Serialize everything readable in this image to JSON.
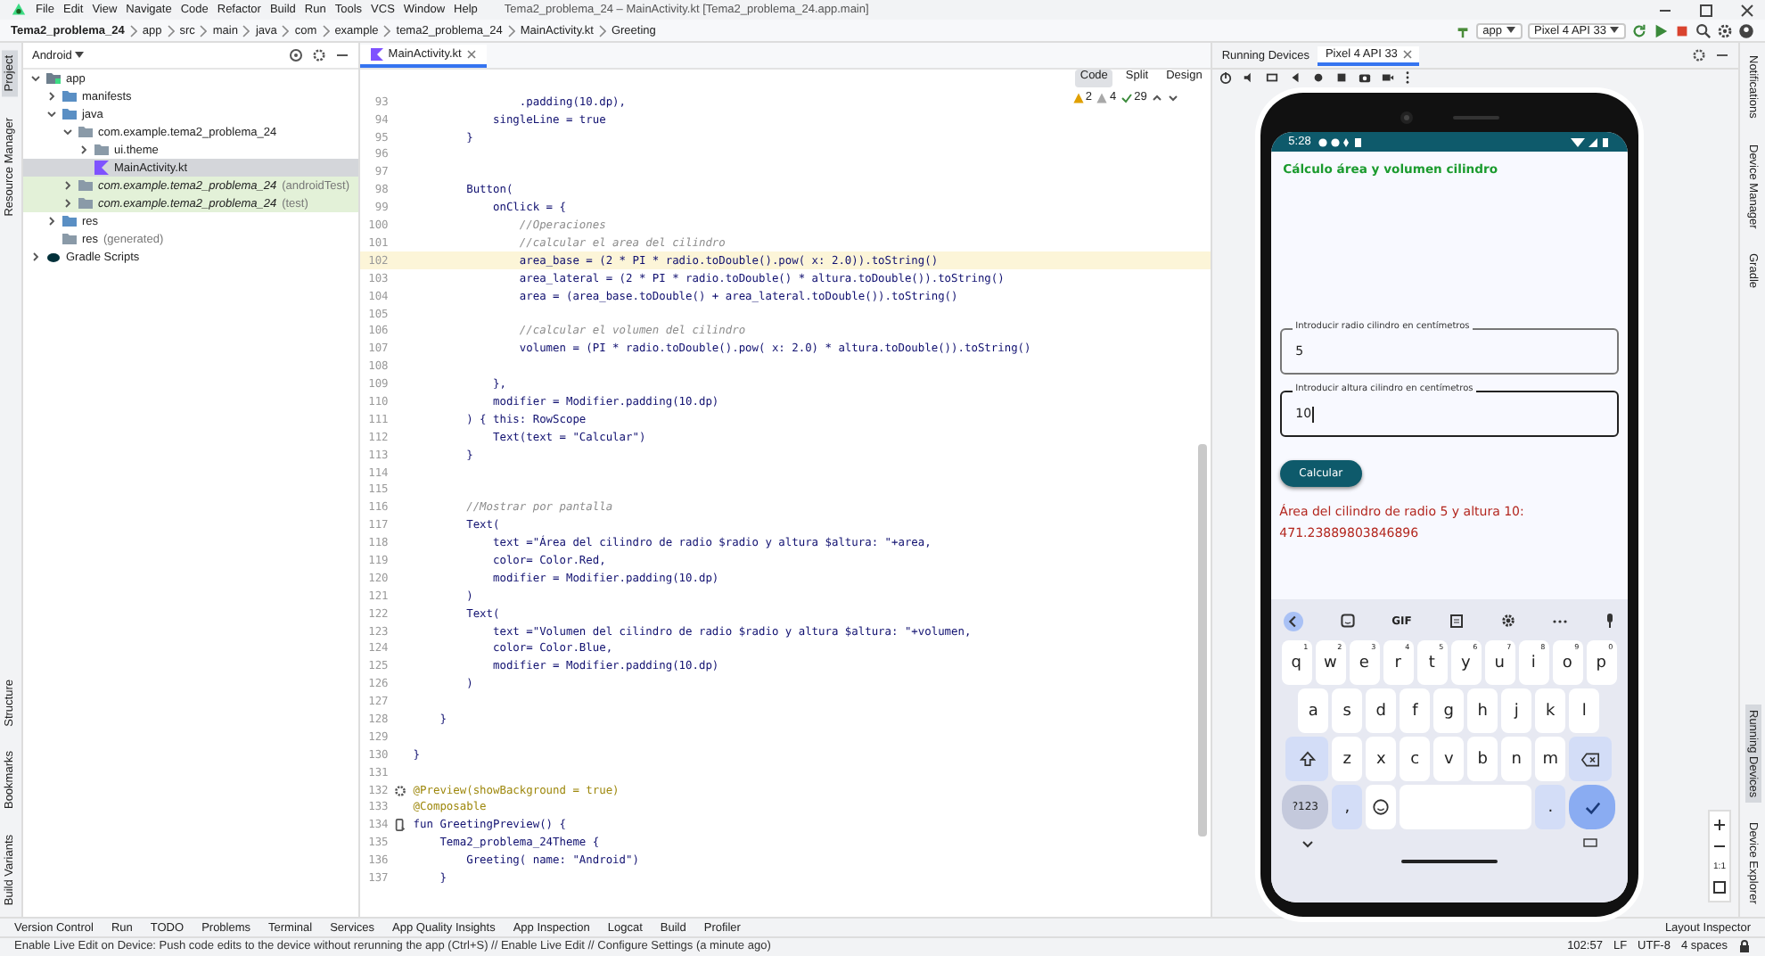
{
  "menu_bar": {
    "items": [
      "File",
      "Edit",
      "View",
      "Navigate",
      "Code",
      "Refactor",
      "Build",
      "Run",
      "Tools",
      "VCS",
      "Window",
      "Help"
    ],
    "title": "Tema2_problema_24 – MainActivity.kt [Tema2_problema_24.app.main]"
  },
  "navigation_bar": {
    "breadcrumbs": [
      "Tema2_problema_24",
      "app",
      "src",
      "main",
      "java",
      "com",
      "example",
      "tema2_problema_24",
      "MainActivity.kt",
      "Greeting"
    ],
    "run_config": "app",
    "device": "Pixel 4 API 33"
  },
  "left_tool_strip": {
    "top": [
      {
        "label": "Project",
        "selected": true
      },
      {
        "label": "Resource Manager",
        "selected": false
      }
    ],
    "bottom": [
      {
        "label": "Structure",
        "selected": false
      },
      {
        "label": "Bookmarks",
        "selected": false
      },
      {
        "label": "Build Variants",
        "selected": false
      }
    ]
  },
  "project_panel": {
    "view": "Android",
    "tree": [
      {
        "label": "app",
        "kind": "module",
        "expanded": true,
        "selected": false,
        "children": [
          {
            "label": "manifests",
            "kind": "folder",
            "expanded": false,
            "selected": false
          },
          {
            "label": "java",
            "kind": "folder",
            "expanded": true,
            "selected": false,
            "children": [
              {
                "label": "com.example.tema2_problema_24",
                "kind": "package",
                "expanded": true,
                "selected": false,
                "children": [
                  {
                    "label": "ui.theme",
                    "kind": "package",
                    "expanded": false,
                    "selected": false
                  },
                  {
                    "label": "MainActivity.kt",
                    "kind": "file",
                    "selected": true
                  }
                ]
              },
              {
                "label": "com.example.tema2_problema_24",
                "suffix": "(androidTest)",
                "kind": "test_package",
                "expanded": false,
                "selected": false
              },
              {
                "label": "com.example.tema2_problema_24",
                "suffix": "(test)",
                "kind": "test_package",
                "expanded": false,
                "selected": false
              }
            ]
          },
          {
            "label": "res",
            "kind": "folder",
            "expanded": false,
            "selected": false
          },
          {
            "label": "res",
            "suffix": "(generated)",
            "kind": "folder_plain",
            "selected": false
          }
        ]
      },
      {
        "label": "Gradle Scripts",
        "kind": "gradle",
        "expanded": false,
        "selected": false
      }
    ]
  },
  "editor": {
    "tab": "MainActivity.kt",
    "view_modes": [
      {
        "label": "Code",
        "selected": true
      },
      {
        "label": "Split",
        "selected": false
      },
      {
        "label": "Design",
        "selected": false
      }
    ],
    "inspections": [
      {
        "kind": "warning",
        "count": "2"
      },
      {
        "kind": "weak_warning",
        "count": "4"
      },
      {
        "kind": "ok",
        "count": "29"
      }
    ],
    "lines": [
      {
        "number": "93",
        "text": "                .padding(10.dp),",
        "kind": "code",
        "current": false
      },
      {
        "number": "94",
        "text": "            singleLine = true",
        "kind": "code",
        "current": false
      },
      {
        "number": "95",
        "text": "        }",
        "kind": "code",
        "current": false
      },
      {
        "number": "96",
        "current": false
      },
      {
        "number": "97",
        "current": false
      },
      {
        "number": "98",
        "text": "        Button(",
        "kind": "code",
        "current": false
      },
      {
        "number": "99",
        "text": "            onClick = {",
        "kind": "code",
        "current": false
      },
      {
        "number": "100",
        "text": "                //Operaciones",
        "kind": "comment",
        "current": false
      },
      {
        "number": "101",
        "text": "                //calcular el area del cilindro",
        "kind": "comment",
        "current": false
      },
      {
        "number": "102",
        "text": "                area_base = (2 * PI * radio.toDouble().pow( x: 2.0)).toString()",
        "kind": "code",
        "current": true
      },
      {
        "number": "103",
        "text": "                area_lateral = (2 * PI * radio.toDouble() * altura.toDouble()).toString()",
        "kind": "code",
        "current": false
      },
      {
        "number": "104",
        "text": "                area = (area_base.toDouble() + area_lateral.toDouble()).toString()",
        "kind": "code",
        "current": false
      },
      {
        "number": "105",
        "current": false
      },
      {
        "number": "106",
        "text": "                //calcular el volumen del cilindro",
        "kind": "comment",
        "current": false
      },
      {
        "number": "107",
        "text": "                volumen = (PI * radio.toDouble().pow( x: 2.0) * altura.toDouble()).toString()",
        "kind": "code",
        "current": false
      },
      {
        "number": "108",
        "current": false
      },
      {
        "number": "109",
        "text": "            },",
        "kind": "code",
        "current": false
      },
      {
        "number": "110",
        "text": "            modifier = Modifier.padding(10.dp)",
        "kind": "code",
        "current": false
      },
      {
        "number": "111",
        "text": "        ) { this: RowScope",
        "kind": "code",
        "current": false
      },
      {
        "number": "112",
        "text": "            Text(text = \"Calcular\")",
        "kind": "code",
        "current": false
      },
      {
        "number": "113",
        "text": "        }",
        "kind": "code",
        "current": false
      },
      {
        "number": "114",
        "current": false
      },
      {
        "number": "115",
        "current": false
      },
      {
        "number": "116",
        "text": "        //Mostrar por pantalla",
        "kind": "comment",
        "current": false
      },
      {
        "number": "117",
        "text": "        Text(",
        "kind": "code",
        "current": false
      },
      {
        "number": "118",
        "text": "            text =\"Área del cilindro de radio $radio y altura $altura: \"+area,",
        "kind": "code",
        "current": false
      },
      {
        "number": "119",
        "text": "            color= Color.Red,",
        "kind": "code",
        "current": false
      },
      {
        "number": "120",
        "text": "            modifier = Modifier.padding(10.dp)",
        "kind": "code",
        "current": false
      },
      {
        "number": "121",
        "text": "        )",
        "kind": "code",
        "current": false
      },
      {
        "number": "122",
        "text": "        Text(",
        "kind": "code",
        "current": false
      },
      {
        "number": "123",
        "text": "            text =\"Volumen del cilindro de radio $radio y altura $altura: \"+volumen,",
        "kind": "code",
        "current": false
      },
      {
        "number": "124",
        "text": "            color= Color.Blue,",
        "kind": "code",
        "current": false
      },
      {
        "number": "125",
        "text": "            modifier = Modifier.padding(10.dp)",
        "kind": "code",
        "current": false
      },
      {
        "number": "126",
        "text": "        )",
        "kind": "code",
        "current": false
      },
      {
        "number": "127",
        "current": false
      },
      {
        "number": "128",
        "text": "    }",
        "kind": "code",
        "current": false
      },
      {
        "number": "129",
        "current": false
      },
      {
        "number": "130",
        "text": "}",
        "kind": "code",
        "current": false
      },
      {
        "number": "131",
        "current": false
      },
      {
        "number": "132",
        "text": "@Preview(showBackground = true)",
        "kind": "preview_annotation",
        "current": false
      },
      {
        "number": "133",
        "text": "@Composable",
        "kind": "annotation",
        "current": false
      },
      {
        "number": "134",
        "text": "fun GreetingPreview() {",
        "kind": "runnable_code",
        "current": false
      },
      {
        "number": "135",
        "text": "    Tema2_problema_24Theme {",
        "kind": "code",
        "current": false
      },
      {
        "number": "136",
        "text": "        Greeting( name: \"Android\")",
        "kind": "code",
        "current": false
      },
      {
        "number": "137",
        "text": "    }",
        "kind": "code",
        "current": false
      }
    ]
  },
  "running_devices": {
    "title": "Running Devices",
    "device_tab": "Pixel 4 API 33",
    "phone": {
      "time": "5:28",
      "app_title": "Cálculo área y volumen cilindro",
      "fields": [
        {
          "label": "Introducir radio cilindro en centímetros",
          "value": "5",
          "focused": false
        },
        {
          "label": "Introducir altura cilindro en centímetros",
          "value": "10",
          "focused": true
        }
      ],
      "button": "Calcular",
      "result": "Área del cilindro de radio 5 y altura 10: 471.23889803846896",
      "keyboard": {
        "gif_label": "GIF",
        "rows": [
          {
            "keys": [
              {
                "kind": "letter",
                "label": "q",
                "hint": "1"
              },
              {
                "kind": "letter",
                "label": "w",
                "hint": "2"
              },
              {
                "kind": "letter",
                "label": "e",
                "hint": "3"
              },
              {
                "kind": "letter",
                "label": "r",
                "hint": "4"
              },
              {
                "kind": "letter",
                "label": "t",
                "hint": "5"
              },
              {
                "kind": "letter",
                "label": "y",
                "hint": "6"
              },
              {
                "kind": "letter",
                "label": "u",
                "hint": "7"
              },
              {
                "kind": "letter",
                "label": "i",
                "hint": "8"
              },
              {
                "kind": "letter",
                "label": "o",
                "hint": "9"
              },
              {
                "kind": "letter",
                "label": "p",
                "hint": "0"
              }
            ]
          },
          {
            "keys": [
              {
                "kind": "letter",
                "label": "a"
              },
              {
                "kind": "letter",
                "label": "s"
              },
              {
                "kind": "letter",
                "label": "d"
              },
              {
                "kind": "letter",
                "label": "f"
              },
              {
                "kind": "letter",
                "label": "g"
              },
              {
                "kind": "letter",
                "label": "h"
              },
              {
                "kind": "letter",
                "label": "j"
              },
              {
                "kind": "letter",
                "label": "k"
              },
              {
                "kind": "letter",
                "label": "l"
              }
            ]
          },
          {
            "keys": [
              {
                "kind": "shift"
              },
              {
                "kind": "letter",
                "label": "z"
              },
              {
                "kind": "letter",
                "label": "x"
              },
              {
                "kind": "letter",
                "label": "c"
              },
              {
                "kind": "letter",
                "label": "v"
              },
              {
                "kind": "letter",
                "label": "b"
              },
              {
                "kind": "letter",
                "label": "n"
              },
              {
                "kind": "letter",
                "label": "m"
              },
              {
                "kind": "backspace"
              }
            ]
          },
          {
            "keys": [
              {
                "kind": "symbols",
                "label": "?123"
              },
              {
                "kind": "punct",
                "label": ","
              },
              {
                "kind": "emoji"
              },
              {
                "kind": "space"
              },
              {
                "kind": "punct",
                "label": "."
              },
              {
                "kind": "done"
              }
            ]
          }
        ]
      }
    }
  },
  "right_tool_strip": {
    "top": [
      {
        "label": "Notifications",
        "selected": false
      },
      {
        "label": "Device Manager",
        "selected": false
      },
      {
        "label": "Gradle",
        "selected": false
      }
    ],
    "bottom": [
      {
        "label": "Running Devices",
        "selected": true
      },
      {
        "label": "Device Explorer",
        "selected": false
      }
    ]
  },
  "zoom_controls": {
    "actual_size": "1:1"
  },
  "bottom_tool_bar": {
    "items": [
      "Version Control",
      "Run",
      "TODO",
      "Problems",
      "Terminal",
      "Services",
      "App Quality Insights",
      "App Inspection",
      "Logcat",
      "Build",
      "Profiler"
    ],
    "right": "Layout Inspector"
  },
  "status_bar": {
    "message": "Enable Live Edit on Device: Push code edits to the device without rerunning the app (Ctrl+S) // Enable Live Edit // Configure Settings (a minute ago)",
    "items": [
      "102:57",
      "LF",
      "UTF-8",
      "4 spaces"
    ]
  }
}
